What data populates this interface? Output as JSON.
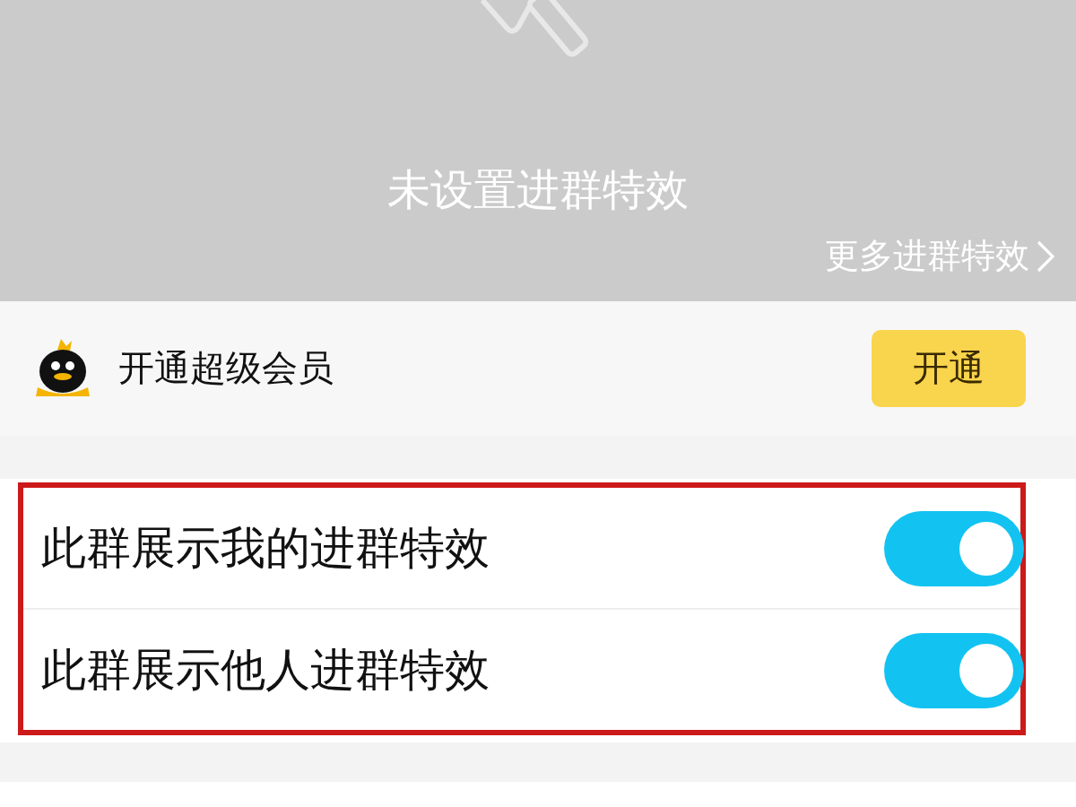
{
  "banner": {
    "title": "未设置进群特效",
    "more_link": "更多进群特效"
  },
  "vip_row": {
    "label": "开通超级会员",
    "button": "开通"
  },
  "settings": [
    {
      "label": "此群展示我的进群特效",
      "on": true
    },
    {
      "label": "此群展示他人进群特效",
      "on": true
    }
  ],
  "highlight": {
    "color": "#cc1a1a"
  }
}
